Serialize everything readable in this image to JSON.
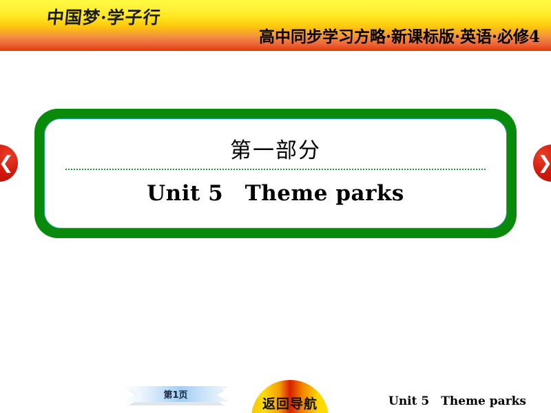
{
  "header": {
    "brand_logo": "中国梦·学子行",
    "title": "高中同步学习方略·新课标版·英语·必修4",
    "gradient_top": "#fffb3f",
    "gradient_bottom": "#e03b06"
  },
  "nav": {
    "prev_icon": "chevron-left-icon",
    "prev_glyph": "❮",
    "next_icon": "chevron-right-icon",
    "next_glyph": "❯",
    "button_color": "#d0190c"
  },
  "main": {
    "part_title": "第一部分",
    "unit_title": "Unit 5　Theme parks",
    "panel_border_color": "#0a8a0a",
    "panel_inner_border_color": "#1f9e9e",
    "divider_color": "#1f8f3f"
  },
  "footer": {
    "page_label": "第1页",
    "nav_button_label": "返回导航",
    "unit_label": "Unit 5　Theme parks",
    "ribbon_color": "#9fcef5",
    "dome_color": "#d91f00"
  }
}
